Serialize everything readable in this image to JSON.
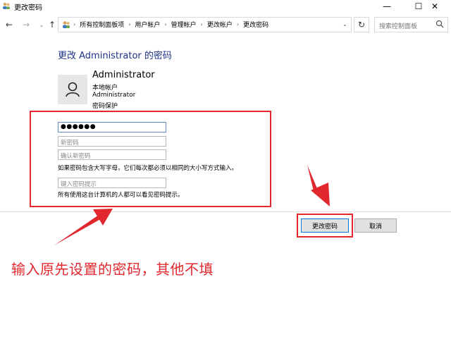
{
  "window": {
    "title": "更改密码",
    "min_glyph": "—",
    "max_glyph": "☐",
    "close_glyph": "✕"
  },
  "nav": {
    "back_glyph": "←",
    "forward_glyph": "→",
    "history_glyph": "⌄",
    "up_glyph": "↑",
    "refresh_glyph": "↻"
  },
  "breadcrumb": [
    "所有控制面板项",
    "用户帐户",
    "管理帐户",
    "更改帐户",
    "更改密码"
  ],
  "breadcrumb_sep": "›",
  "search": {
    "placeholder": "搜索控制面板"
  },
  "main": {
    "heading": "更改 Administrator 的密码"
  },
  "user": {
    "name": "Administrator",
    "account_type": "本地帐户",
    "account_name": "Administrator",
    "protection": "密码保护"
  },
  "form": {
    "current_password_value": "●●●●●●",
    "new_password_placeholder": "新密码",
    "confirm_password_placeholder": "确认新密码",
    "case_sensitive_note": "如果密码包含大写字母，它们每次都必须以相同的大小写方式输入。",
    "hint_placeholder": "键入密码提示",
    "hint_visibility_note": "所有使用这台计算机的人都可以看见密码提示。"
  },
  "buttons": {
    "change_password": "更改密码",
    "cancel": "取消"
  },
  "annotation": {
    "text": "输入原先设置的密码，其他不填",
    "color": "#e0282e"
  },
  "colors": {
    "heading": "#1e3287",
    "focus_border": "#5b8ac7",
    "default_button_border": "#0078d7"
  }
}
